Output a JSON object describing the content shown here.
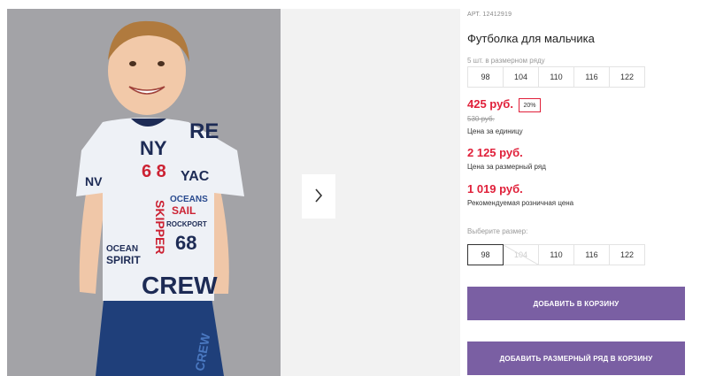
{
  "product": {
    "article": "АРТ. 12412919",
    "title": "Футболка для мальчика",
    "size_hint": "5 шт. в размерном ряду",
    "size_row_sizes": [
      "98",
      "104",
      "110",
      "116",
      "122"
    ],
    "price_unit": "425 руб.",
    "discount": "20%",
    "old_price": "530 руб.",
    "price_unit_caption": "Цена за единицу",
    "price_row": "2 125 руб.",
    "price_row_caption": "Цена за размерный ряд",
    "price_retail": "1 019 руб.",
    "price_retail_caption": "Рекомендуемая розничная цена",
    "choose_size_label": "Выберите размер:",
    "size_options": [
      {
        "label": "98",
        "state": "selected"
      },
      {
        "label": "104",
        "state": "disabled"
      },
      {
        "label": "110",
        "state": "available"
      },
      {
        "label": "116",
        "state": "available"
      },
      {
        "label": "122",
        "state": "available"
      }
    ],
    "add_to_cart": "ДОБАВИТЬ В КОРЗИНУ",
    "add_row_to_cart": "ДОБАВИТЬ РАЗМЕРНЫЙ РЯД В КОРЗИНУ"
  },
  "gallery": {
    "next_icon": "chevron-right-icon"
  },
  "colors": {
    "accent": "#7a5fa3",
    "price": "#e0203a"
  }
}
